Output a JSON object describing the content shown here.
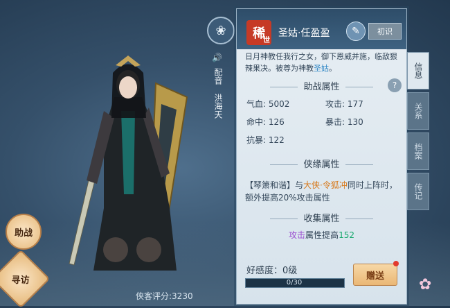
{
  "character": {
    "rarity": "稀",
    "rarity_sub": "世",
    "name": "圣姑·任盈盈",
    "stage": "初识",
    "bio_text_1": "日月神教任我行之女，御下恩威并施，临敌狠辣果决。被尊为神教",
    "bio_highlight": "圣姑",
    "bio_text_2": "。"
  },
  "voice": {
    "label": "配音",
    "actor": "洪海天"
  },
  "sections": {
    "battle": "助战属性",
    "bond": "侠缘属性",
    "collect": "收集属性"
  },
  "battle_stats": [
    {
      "label": "气血:",
      "value": "5002"
    },
    {
      "label": "攻击:",
      "value": "177"
    },
    {
      "label": "命中:",
      "value": "126"
    },
    {
      "label": "暴击:",
      "value": "130"
    },
    {
      "label": "抗暴:",
      "value": "122"
    }
  ],
  "bond": {
    "skill": "【琴箫和谐】",
    "with": "与",
    "partner": "大侠·令狐冲",
    "effect": "同时上阵时，额外提高20%攻击属性"
  },
  "collect": {
    "attr": "攻击",
    "text": "属性提高",
    "value": "152"
  },
  "favor": {
    "label": "好感度：0级",
    "progress": "0/30",
    "progress_fraction": 0.0
  },
  "buttons": {
    "gift": "赠送",
    "assist": "助战",
    "visit": "寻访",
    "help": "?"
  },
  "tabs": [
    "信息",
    "关系",
    "档案",
    "传记"
  ],
  "score": "侠客评分:3230",
  "colors": {
    "accent_orange": "#d7791c",
    "accent_purple": "#9b4fd0",
    "accent_green": "#14a86b",
    "accent_blue": "#2e86c5",
    "rarity_red": "#c63a26"
  }
}
